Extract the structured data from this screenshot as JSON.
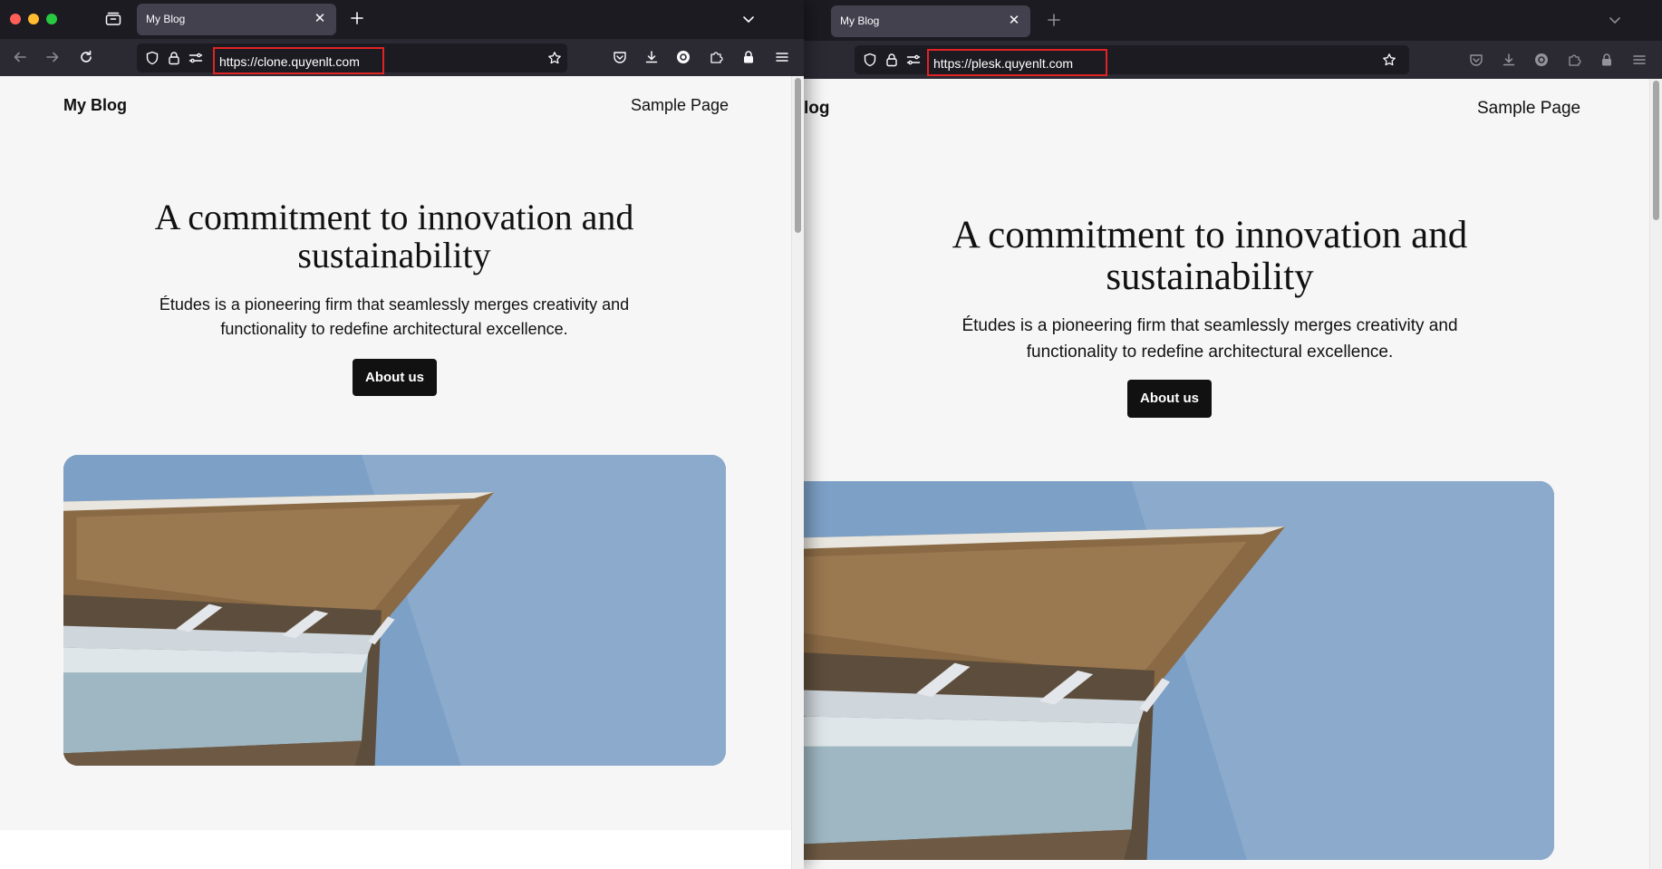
{
  "left_window": {
    "tab": {
      "title": "My Blog"
    },
    "url": "https://clone.quyenlt.com",
    "site": {
      "title": "My Blog",
      "nav_link": "Sample Page",
      "hero_heading": "A commitment to innovation and sustainability",
      "hero_text": "Études is a pioneering firm that seamlessly merges creativity and functionality to redefine architectural excellence.",
      "cta_label": "About us"
    }
  },
  "right_window": {
    "tab": {
      "title": "My Blog"
    },
    "url": "https://plesk.quyenlt.com",
    "site": {
      "title_partial": "log",
      "nav_link": "Sample Page",
      "hero_heading": "A commitment to innovation and sustainability",
      "hero_text": "Études is a pioneering firm that seamlessly merges creativity and functionality to redefine architectural excellence.",
      "cta_label": "About us"
    }
  },
  "icons": {
    "tab_overview": "tab-overview-icon",
    "new_tab": "plus-icon",
    "list_all_tabs": "chevron-down-icon",
    "back": "back-arrow-icon",
    "forward": "forward-arrow-icon",
    "reload": "reload-icon",
    "tracking_protection": "shield-icon",
    "permissions": "lock-icon",
    "site_settings": "sliders-icon",
    "bookmark": "star-icon",
    "pocket": "pocket-icon",
    "downloads": "download-icon",
    "account": "account-icon",
    "extensions": "puzzle-icon",
    "password": "lock-icon",
    "menu": "hamburger-icon"
  },
  "colors": {
    "traffic_red": "#ff5f57",
    "traffic_yellow": "#febc2e",
    "traffic_green": "#28c840",
    "url_highlight": "#e02424",
    "button_bg": "#111111",
    "page_bg": "#f6f6f6"
  }
}
